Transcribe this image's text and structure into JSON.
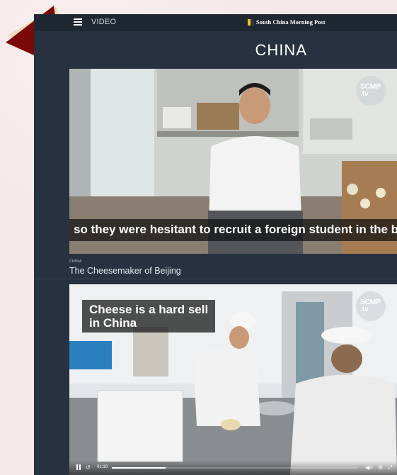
{
  "header": {
    "section": "VIDEO",
    "brand": "South China Morning Post",
    "page_title": "CHINA"
  },
  "video1": {
    "caption": "so they were hesitant to recruit a foreign student in the beginning.",
    "watermark_line1": "SCMP",
    "watermark_line2": ".tv"
  },
  "story": {
    "category": "CHINA",
    "title": "The Cheesemaker of Beijing"
  },
  "video2": {
    "overlay_line1": "Cheese is a hard sell",
    "overlay_line2": "in China",
    "watermark_line1": "SCMP",
    "watermark_line2": ".tv",
    "time": "01:10",
    "progress": 0.22
  },
  "icons": [
    "menu-icon",
    "pause-icon",
    "rewind-icon",
    "mute-icon",
    "gear-icon",
    "fullscreen-icon"
  ],
  "colors": {
    "app_bg": "#27313f",
    "brand_logo": "#f5c518",
    "arrow": "#7a0a0a"
  }
}
